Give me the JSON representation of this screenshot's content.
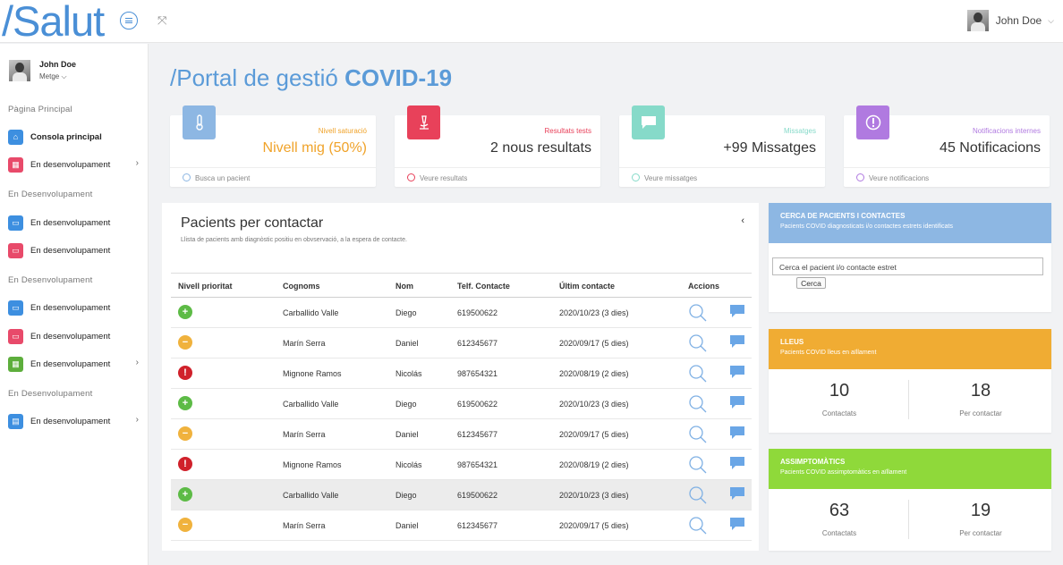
{
  "header": {
    "logo": "/Salut",
    "user_name": "John Doe"
  },
  "sidebar": {
    "user": {
      "name": "John Doe",
      "role": "Metge"
    },
    "sections": [
      "Pàgina Principal",
      "En Desenvolupament",
      "En Desenvolupament",
      "En Desenvolupament"
    ],
    "items": [
      {
        "label": "Consola principal",
        "color": "#3d8fe0"
      },
      {
        "label": "En desenvolupament",
        "color": "#e84a6a"
      },
      {
        "label": "En desenvolupament",
        "color": "#3d8fe0"
      },
      {
        "label": "En desenvolupament",
        "color": "#e84a6a"
      },
      {
        "label": "En desenvolupament",
        "color": "#3d8fe0"
      },
      {
        "label": "En desenvolupament",
        "color": "#e84a6a"
      },
      {
        "label": "En desenvolupament",
        "color": "#5dae3c"
      },
      {
        "label": "En desenvolupament",
        "color": "#3d8fe0"
      }
    ]
  },
  "page": {
    "title_prefix": "/Portal de gestió ",
    "title_bold": "COVID-19"
  },
  "stats": [
    {
      "label": "Nivell saturació",
      "value": "Nivell mig (50%)",
      "footer": "Busca un pacient",
      "color": "#8db7e3",
      "accent": "#f0a32a",
      "icon": "thermometer-icon"
    },
    {
      "label": "Resultats tests",
      "value": "2 nous resultats",
      "footer": "Veure resultats",
      "color": "#e8415a",
      "accent": "#e8415a",
      "icon": "microscope-icon"
    },
    {
      "label": "Missatges",
      "value": "+99 Missatges",
      "footer": "Veure missatges",
      "color": "#86dac9",
      "accent": "#86dac9",
      "icon": "message-icon"
    },
    {
      "label": "Notificacions internes",
      "value": "45 Notificacions",
      "footer": "Veure notificacions",
      "color": "#b07ae0",
      "accent": "#b07ae0",
      "icon": "alert-icon"
    }
  ],
  "patients": {
    "title": "Pacients per contactar",
    "subtitle": "Llista de pacients amb diagnòstic positiu en obvservació, a la espera de contacte.",
    "collapse": "‹",
    "columns": [
      "Nivell prioritat",
      "Cognoms",
      "Nom",
      "Telf. Contacte",
      "Últim contacte",
      "Accions"
    ],
    "rows": [
      {
        "priority": "green",
        "surname": "Carballido Valle",
        "name": "Diego",
        "phone": "619500622",
        "last": "2020/10/23 (3 dies)"
      },
      {
        "priority": "orange",
        "surname": "Marín Serra",
        "name": "Daniel",
        "phone": "612345677",
        "last": "2020/09/17 (5 dies)"
      },
      {
        "priority": "red",
        "surname": "Mignone Ramos",
        "name": "Nicolás",
        "phone": "987654321",
        "last": "2020/08/19 (2 dies)"
      },
      {
        "priority": "green",
        "surname": "Carballido Valle",
        "name": "Diego",
        "phone": "619500622",
        "last": "2020/10/23 (3 dies)"
      },
      {
        "priority": "orange",
        "surname": "Marín Serra",
        "name": "Daniel",
        "phone": "612345677",
        "last": "2020/09/17 (5 dies)"
      },
      {
        "priority": "red",
        "surname": "Mignone Ramos",
        "name": "Nicolás",
        "phone": "987654321",
        "last": "2020/08/19 (2 dies)"
      },
      {
        "priority": "green",
        "surname": "Carballido Valle",
        "name": "Diego",
        "phone": "619500622",
        "last": "2020/10/23 (3 dies)",
        "highlight": true
      },
      {
        "priority": "orange",
        "surname": "Marín Serra",
        "name": "Daniel",
        "phone": "612345677",
        "last": "2020/09/17 (5 dies)"
      }
    ]
  },
  "search_card": {
    "title": "Cerca de pacients i contactes",
    "subtitle": "Pacients COVID diagnosticats i/o contactes estrets identificats",
    "input_value": "Cerca el pacient i/o contacte estret",
    "button": "Cerca",
    "color": "#8db7e3"
  },
  "lleus": {
    "title": "Lleus",
    "subtitle": "Pacients COVID lleus en aïllament",
    "contacted": "10",
    "contacted_label": "Contactats",
    "pending": "18",
    "pending_label": "Per contactar",
    "color": "#f0ac33"
  },
  "asimpt": {
    "title": "Assimptomàtics",
    "subtitle": "Pacients COVID assimptomàtics en aïllament",
    "contacted": "63",
    "contacted_label": "Contactats",
    "pending": "19",
    "pending_label": "Per contactar",
    "color": "#8fd93a"
  }
}
